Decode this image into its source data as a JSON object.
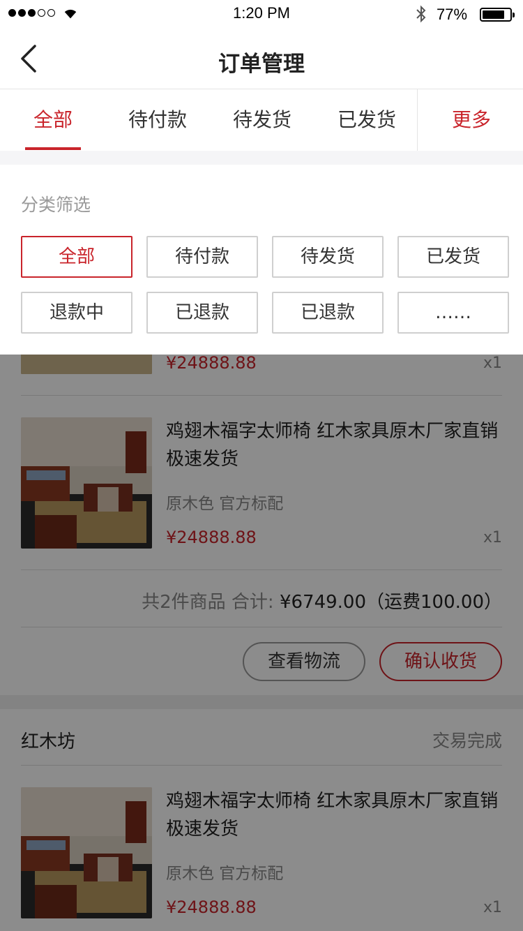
{
  "status_bar": {
    "time": "1:20 PM",
    "battery": "77%",
    "battery_level": 0.77
  },
  "nav": {
    "title": "订单管理"
  },
  "tabs": [
    {
      "label": "全部",
      "active": true
    },
    {
      "label": "待付款"
    },
    {
      "label": "待发货"
    },
    {
      "label": "已发货"
    }
  ],
  "more_tab": "更多",
  "filter": {
    "title": "分类筛选",
    "chips": [
      "全部",
      "待付款",
      "待发货",
      "已发货",
      "退款中",
      "已退款",
      "已退款",
      "……"
    ],
    "selected": "全部"
  },
  "order1": {
    "item_partial": {
      "price": "¥24888.88",
      "qty": "x1"
    },
    "item": {
      "name": "鸡翅木福字太师椅 红木家具原木厂家直销 极速发货",
      "spec": "原木色 官方标配",
      "price": "¥24888.88",
      "qty": "x1"
    },
    "summary": {
      "count": "共2件商品 合计:",
      "amount": "¥6749.00（运费100.00）"
    },
    "buttons": {
      "logistics": "查看物流",
      "confirm": "确认收货"
    }
  },
  "order2": {
    "shop": "红木坊",
    "status": "交易完成",
    "item": {
      "name": "鸡翅木福字太师椅 红木家具原木厂家直销 极速发货",
      "spec": "原木色 官方标配",
      "price": "¥24888.88",
      "qty": "x1"
    }
  },
  "colors": {
    "accent": "#c9242b",
    "dim": "rgba(0,0,0,0.45)"
  }
}
